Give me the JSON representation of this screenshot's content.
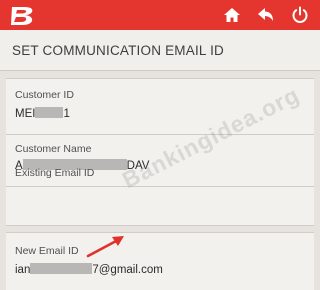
{
  "header": {
    "home_icon": "home-icon",
    "back_icon": "back-arrow-icon",
    "power_icon": "power-icon",
    "accent": "#e4362e"
  },
  "page": {
    "title": "SET COMMUNICATION EMAIL ID"
  },
  "fields": {
    "customer_id": {
      "label": "Customer ID",
      "value_prefix": "MEI",
      "value_suffix": "1"
    },
    "customer_name": {
      "label": "Customer Name",
      "value_prefix": "A",
      "value_suffix": "DAV"
    },
    "existing_email": {
      "label": "Existing Email ID",
      "value": ""
    },
    "new_email": {
      "label": "New Email ID",
      "value_prefix": "ian",
      "value_suffix": "7@gmail.com"
    }
  },
  "watermark": "Bankingidea.org"
}
